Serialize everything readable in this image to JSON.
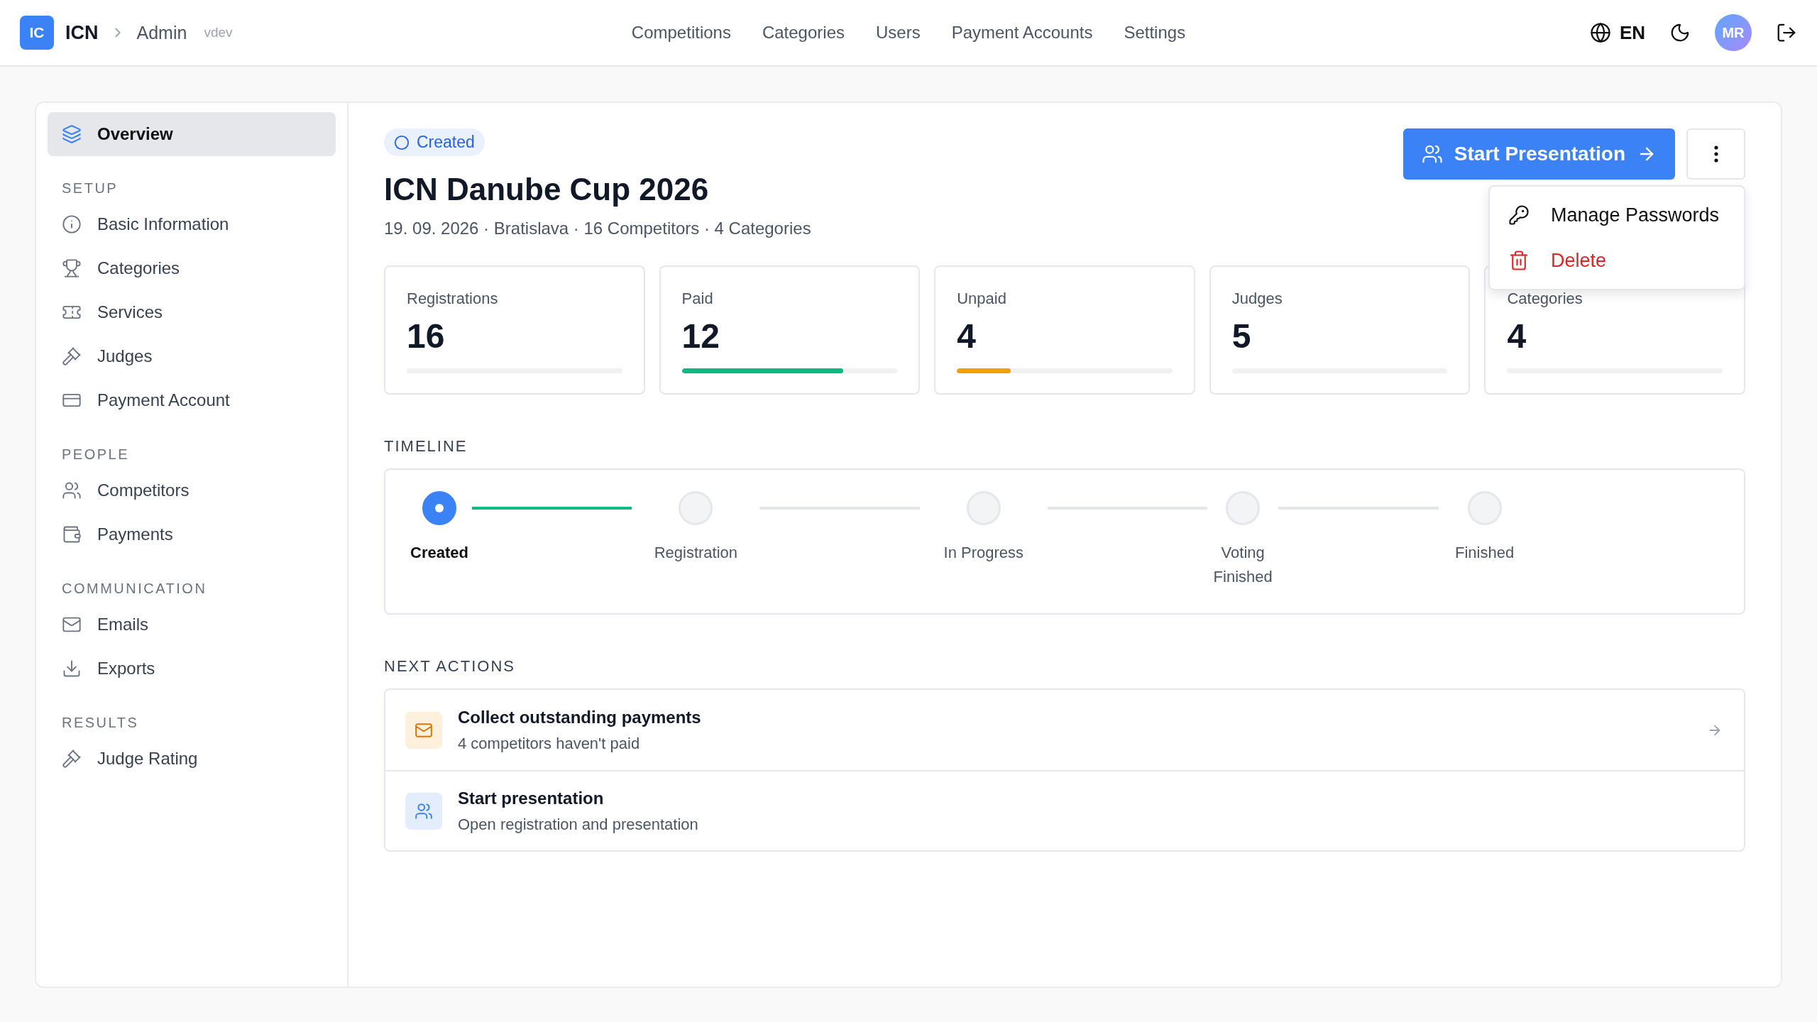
{
  "header": {
    "logo": "IC",
    "brand": "ICN",
    "breadcrumb": "Admin",
    "env": "vdev",
    "nav": [
      "Competitions",
      "Categories",
      "Users",
      "Payment Accounts",
      "Settings"
    ],
    "language": "EN",
    "avatar": "MR"
  },
  "sidebar": {
    "top": {
      "label": "Overview",
      "selected": true
    },
    "sections": [
      {
        "title": "SETUP",
        "items": [
          {
            "label": "Basic Information",
            "selected": false
          },
          {
            "label": "Categories",
            "selected": false
          },
          {
            "label": "Services",
            "selected": false
          },
          {
            "label": "Judges",
            "selected": false
          },
          {
            "label": "Payment Account",
            "selected": false
          }
        ]
      },
      {
        "title": "PEOPLE",
        "items": [
          {
            "label": "Competitors",
            "selected": false
          },
          {
            "label": "Payments",
            "selected": false
          }
        ]
      },
      {
        "title": "COMMUNICATION",
        "items": [
          {
            "label": "Emails",
            "selected": false
          },
          {
            "label": "Exports",
            "selected": false
          }
        ]
      },
      {
        "title": "RESULTS",
        "items": [
          {
            "label": "Judge Rating",
            "selected": false
          }
        ]
      }
    ]
  },
  "status_badge": "Created",
  "title": "ICN Danube Cup 2026",
  "subtitle": "19. 09. 2026 · Bratislava · 16 Competitors · 4 Categories",
  "primary_button": "Start Presentation",
  "menu": [
    {
      "label": "Manage Passwords",
      "kind": "normal"
    },
    {
      "label": "Delete",
      "kind": "danger"
    }
  ],
  "stats": [
    {
      "label": "Registrations",
      "value": "16"
    },
    {
      "label": "Paid",
      "value": "12",
      "level": 0.75,
      "color": "#10b981"
    },
    {
      "label": "Unpaid",
      "value": "4",
      "level": 0.25,
      "color": "#f59e0b"
    },
    {
      "label": "Judges",
      "value": "5"
    },
    {
      "label": "Categories",
      "value": "4"
    }
  ],
  "timeline": {
    "title": "TIMELINE",
    "steps": [
      {
        "label": "Created",
        "current": true
      },
      {
        "label": "Registration",
        "current": false
      },
      {
        "label": "In Progress",
        "current": false
      },
      {
        "label": "Voting Finished",
        "current": false
      },
      {
        "label": "Finished",
        "current": false
      }
    ]
  },
  "next_actions": {
    "title": "NEXT ACTIONS",
    "items": [
      {
        "title": "Collect outstanding payments",
        "subtitle": "4 competitors haven't paid",
        "kind": "payment"
      },
      {
        "title": "Start presentation",
        "subtitle": "Open registration and presentation",
        "kind": "presentation"
      }
    ]
  }
}
